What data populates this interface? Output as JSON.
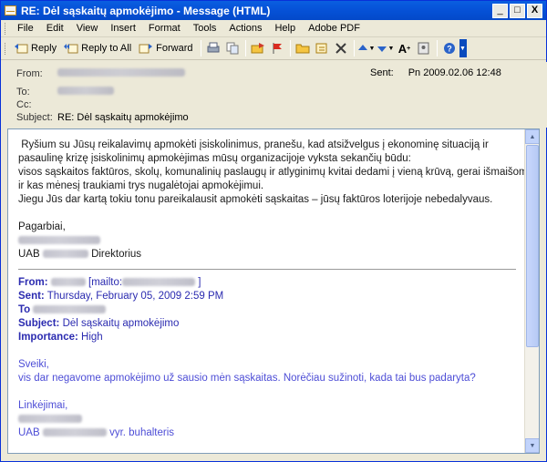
{
  "window": {
    "title": "RE: Dėl sąskaitų apmokėjimo  - Message (HTML)",
    "buttons": {
      "minimize": "_",
      "maximize": "□",
      "close": "X"
    }
  },
  "menu": [
    "File",
    "Edit",
    "View",
    "Insert",
    "Format",
    "Tools",
    "Actions",
    "Help",
    "Adobe PDF"
  ],
  "toolbar": {
    "reply": "Reply",
    "reply_all": "Reply to All",
    "forward": "Forward"
  },
  "headers": {
    "from_label": "From:",
    "to_label": "To:",
    "cc_label": "Cc:",
    "subject_label": "Subject:",
    "subject_value": "RE: Dėl sąskaitų apmokėjimo",
    "sent_label": "Sent:",
    "sent_value": "Pn 2009.02.06 12:48"
  },
  "body": {
    "lines": [
      " Ryšium su Jūsų reikalavimų apmokėti įsiskolinimus, pranešu, kad atsižvelgus į ekonominę situaciją ir",
      "pasaulinę krizę įsiskolinimų apmokėjimas mūsų organizacijoje vyksta sekančių būdu:",
      "visos sąskaitos faktūros, skolų, komunalinių paslaugų ir atlyginimų kvitai dedami į vieną krūvą, gerai išmaišomi",
      "ir kas mėnesį traukiami trys nugalėtojai apmokėjimui.",
      "Jiegu Jūs dar kartą tokiu tonu pareikalausit apmokėti sąskaitas – jūsų faktūros loterijoje nebedalyvaus."
    ],
    "regards": "Pagarbiai,",
    "company_prefix": "UAB",
    "position": "Direktorius"
  },
  "quoted": {
    "from_label": "From:",
    "mailto_open": "[mailto:",
    "mailto_close": "]",
    "sent_label": "Sent:",
    "sent_value": "Thursday, February 05, 2009 2:59 PM",
    "to_label": "To",
    "subject_label": "Subject:",
    "subject_value": "Dėl sąskaitų apmokėjimo",
    "importance_label": "Importance:",
    "importance_value": "High",
    "greeting": "Sveiki,",
    "message": "vis dar negavome apmokėjimo už sausio mėn sąskaitas. Norėčiau sužinoti, kada tai bus padaryta?",
    "closing": "Linkėjimai,",
    "company_prefix": "UAB",
    "position": "vyr. buhalteris"
  }
}
